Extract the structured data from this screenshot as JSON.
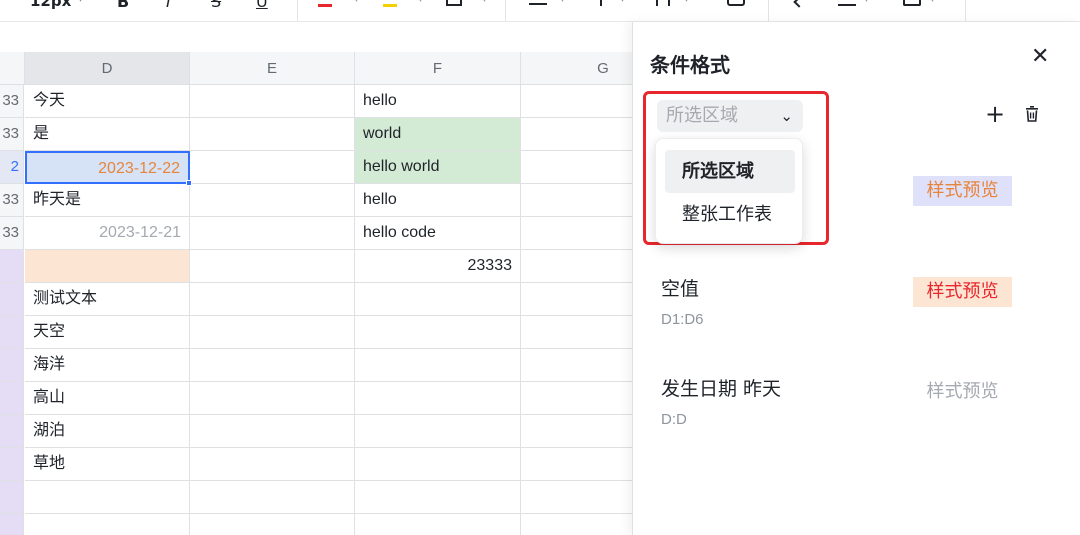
{
  "toolbar": {
    "font_size": "12px",
    "bold": "B",
    "italic": "I",
    "strike": "S",
    "underline": "U"
  },
  "columns": [
    "D",
    "E",
    "F",
    "G"
  ],
  "row_stubs": [
    "33",
    "33",
    "2",
    "33",
    "33",
    "",
    "",
    "",
    "",
    "",
    "",
    "",
    "",
    ""
  ],
  "cells": {
    "D": [
      "今天",
      "是",
      "2023-12-22",
      "昨天是",
      "2023-12-21",
      "",
      "测试文本",
      "天空",
      "海洋",
      "高山",
      "湖泊",
      "草地",
      "",
      ""
    ],
    "F": [
      "hello",
      "world",
      "hello world",
      "hello",
      "hello code",
      "23333",
      "",
      "",
      "",
      "",
      "",
      "",
      "",
      ""
    ]
  },
  "panel": {
    "title": "条件格式",
    "scope_select": {
      "placeholder": "所选区域",
      "options": [
        "所选区域",
        "整张工作表"
      ]
    },
    "rules": [
      {
        "title": "",
        "range": "",
        "preview": "样式预览"
      },
      {
        "title": "空值",
        "range": "D1:D6",
        "preview": "样式预览"
      },
      {
        "title": "发生日期 昨天",
        "range": "D:D",
        "preview": "样式预览"
      }
    ]
  },
  "colors": {
    "accent": "#3370ff",
    "highlight_red": "#e8262d",
    "green_fill": "#d3ead5",
    "peach_fill": "#fde5d3",
    "lavender_fill": "#dfe0f9",
    "orange_text": "#e8843a"
  }
}
